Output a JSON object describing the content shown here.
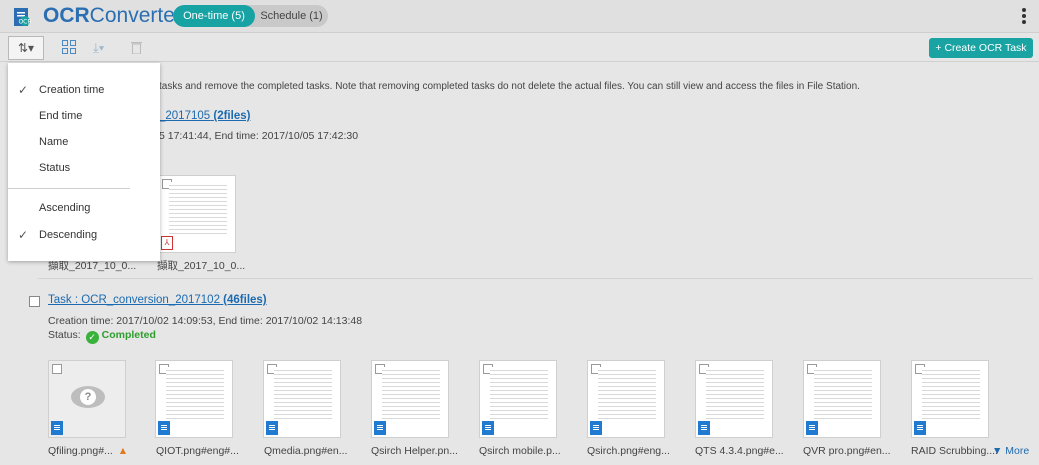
{
  "header": {
    "title_bold": "OCR",
    "title_regular": "Converter",
    "tabs": [
      {
        "label": "One-time (5)",
        "active": true
      },
      {
        "label": "Schedule (1)",
        "active": false
      }
    ]
  },
  "toolbar": {
    "sort_label": "⇅▾",
    "create_label": "+ Create OCR Task"
  },
  "notice": "tasks and remove the completed tasks. Note that removing completed tasks do not delete the actual files. You can still view and access the files in File Station.",
  "sort_menu": {
    "items": [
      {
        "label": "Creation time",
        "checked": true
      },
      {
        "label": "End time",
        "checked": false
      },
      {
        "label": "Name",
        "checked": false
      },
      {
        "label": "Status",
        "checked": false
      }
    ],
    "order": [
      {
        "label": "Ascending",
        "checked": false
      },
      {
        "label": "Descending",
        "checked": true
      }
    ]
  },
  "task1": {
    "title_visible": "_2017105",
    "count": "(2files)",
    "times_visible": "5 17:41:44, End time: 2017/10/05 17:42:30",
    "files": [
      "擷取_2017_10_0...",
      "擷取_2017_10_0..."
    ]
  },
  "task2": {
    "title": "Task : OCR_conversion_2017102",
    "count": "(46files)",
    "times": "Creation time: 2017/10/02 14:09:53, End time: 2017/10/02 14:13:48",
    "status_label": "Status:",
    "status": "Completed",
    "files": [
      "Qfiling.png#...",
      "QIOT.png#eng#...",
      "Qmedia.png#en...",
      "Qsirch Helper.pn...",
      "Qsirch mobile.p...",
      "Qsirch.png#eng...",
      "QTS 4.3.4.png#e...",
      "QVR pro.png#en...",
      "RAID Scrubbing...."
    ],
    "more": "▼ More"
  }
}
